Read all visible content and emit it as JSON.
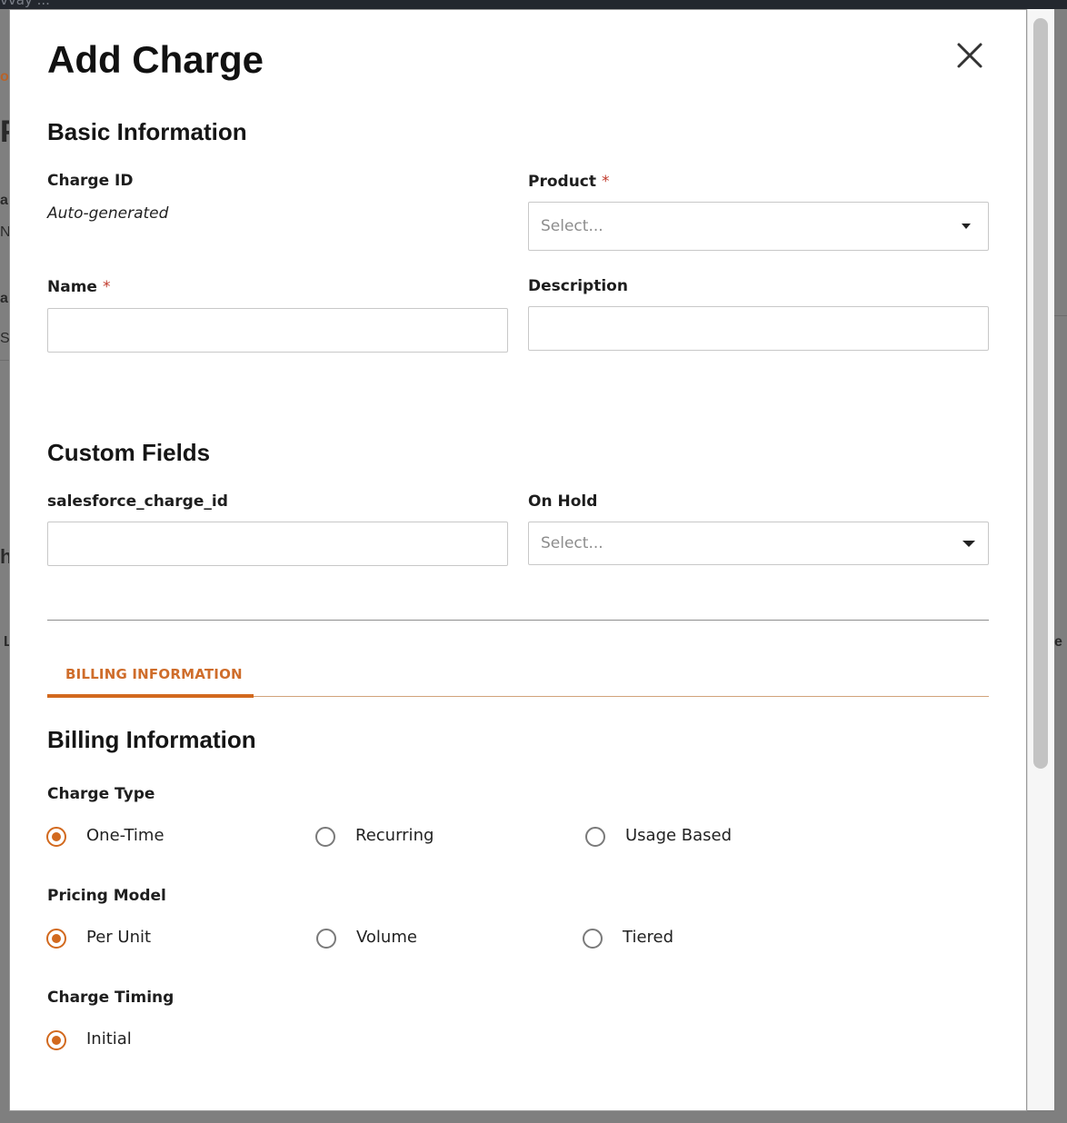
{
  "background": {
    "topbar_text": "vvay ...",
    "fragments": [
      "or",
      "P|",
      "ar",
      "N",
      "ar",
      "Sp",
      "h",
      "L",
      "e"
    ]
  },
  "modal": {
    "title": "Add Charge",
    "close_icon": "close-icon",
    "basic": {
      "section_title": "Basic Information",
      "charge_id_label": "Charge ID",
      "charge_id_value": "Auto-generated",
      "product_label": "Product",
      "product_placeholder": "Select...",
      "name_label": "Name",
      "name_value": "",
      "description_label": "Description",
      "description_value": "",
      "required_marker": "*"
    },
    "custom": {
      "section_title": "Custom Fields",
      "sf_label": "salesforce_charge_id",
      "sf_value": "",
      "on_hold_label": "On Hold",
      "on_hold_placeholder": "Select..."
    },
    "tabs": [
      {
        "label": "BILLING INFORMATION",
        "active": true
      }
    ],
    "billing": {
      "section_title": "Billing Information",
      "charge_type": {
        "label": "Charge Type",
        "options": [
          {
            "label": "One-Time",
            "selected": true
          },
          {
            "label": "Recurring",
            "selected": false
          },
          {
            "label": "Usage Based",
            "selected": false
          }
        ]
      },
      "pricing_model": {
        "label": "Pricing Model",
        "options": [
          {
            "label": "Per Unit",
            "selected": true
          },
          {
            "label": "Volume",
            "selected": false
          },
          {
            "label": "Tiered",
            "selected": false
          }
        ]
      },
      "charge_timing": {
        "label": "Charge Timing",
        "options": [
          {
            "label": "Initial",
            "selected": true
          }
        ]
      }
    }
  },
  "colors": {
    "accent": "#d2691e",
    "required": "#c0392b",
    "border": "#c8c8c8",
    "overlay": "#7f7f7f"
  }
}
